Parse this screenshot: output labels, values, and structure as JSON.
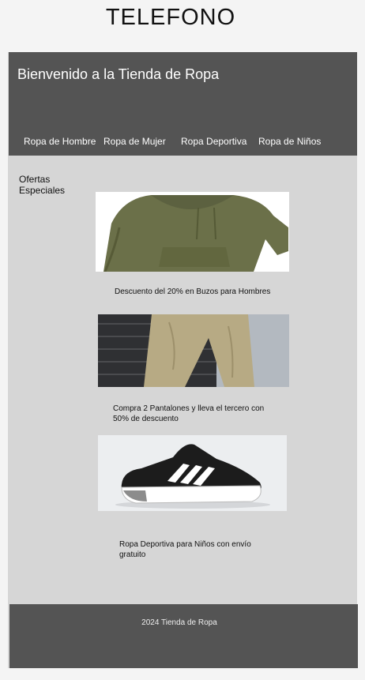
{
  "page": {
    "title": "TELEFONO"
  },
  "header": {
    "welcome": "Bienvenido a la Tienda de Ropa",
    "nav": [
      {
        "label": "Ropa de Hombre"
      },
      {
        "label": "Ropa de Mujer"
      },
      {
        "label": "Ropa Deportiva"
      },
      {
        "label": "Ropa de Niños"
      }
    ]
  },
  "offers": {
    "heading": "Ofertas Especiales",
    "items": [
      {
        "image": "olive-hoodie-photo",
        "text": "Descuento del 20% en Buzos para Hombres"
      },
      {
        "image": "khaki-pants-photo",
        "text": "Compra 2 Pantalones y lleva el tercero con 50% de descuento"
      },
      {
        "image": "black-sneaker-photo",
        "text": "Ropa Deportiva para Niños con envío gratuito"
      }
    ]
  },
  "footer": {
    "text": "2024 Tienda de Ropa"
  },
  "colors": {
    "header_bg": "#545454",
    "content_bg": "#d6d6d6",
    "page_bg": "#f4f4f4"
  }
}
